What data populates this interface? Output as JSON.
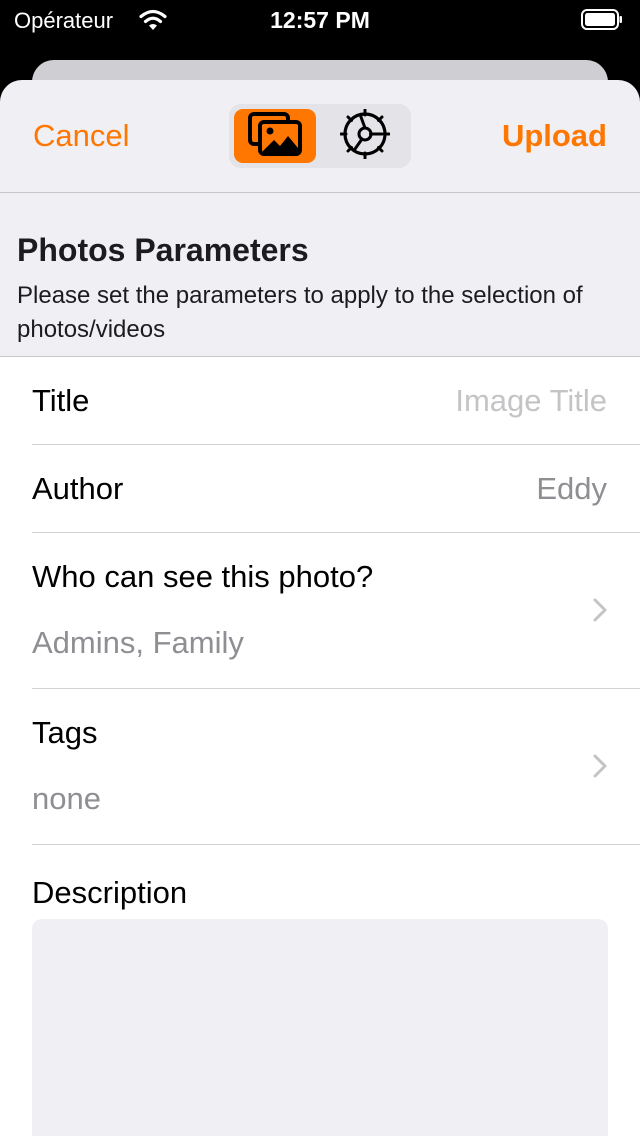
{
  "status_bar": {
    "carrier": "Opérateur",
    "time": "12:57 PM"
  },
  "nav": {
    "cancel_label": "Cancel",
    "upload_label": "Upload",
    "segments": [
      {
        "icon": "photos-icon",
        "selected": true
      },
      {
        "icon": "gear-icon",
        "selected": false
      }
    ]
  },
  "section": {
    "title": "Photos Parameters",
    "subtitle": "Please set the parameters to apply to the selection of photos/videos"
  },
  "form": {
    "title_label": "Title",
    "title_placeholder": "Image Title",
    "author_label": "Author",
    "author_value": "Eddy",
    "privacy_label": "Who can see this photo?",
    "privacy_value": "Admins, Family",
    "tags_label": "Tags",
    "tags_value": "none",
    "description_label": "Description",
    "description_value": ""
  },
  "colors": {
    "accent": "#ff7700",
    "sheet_background": "#f0eff4",
    "secondary_text": "#8e8e93"
  }
}
